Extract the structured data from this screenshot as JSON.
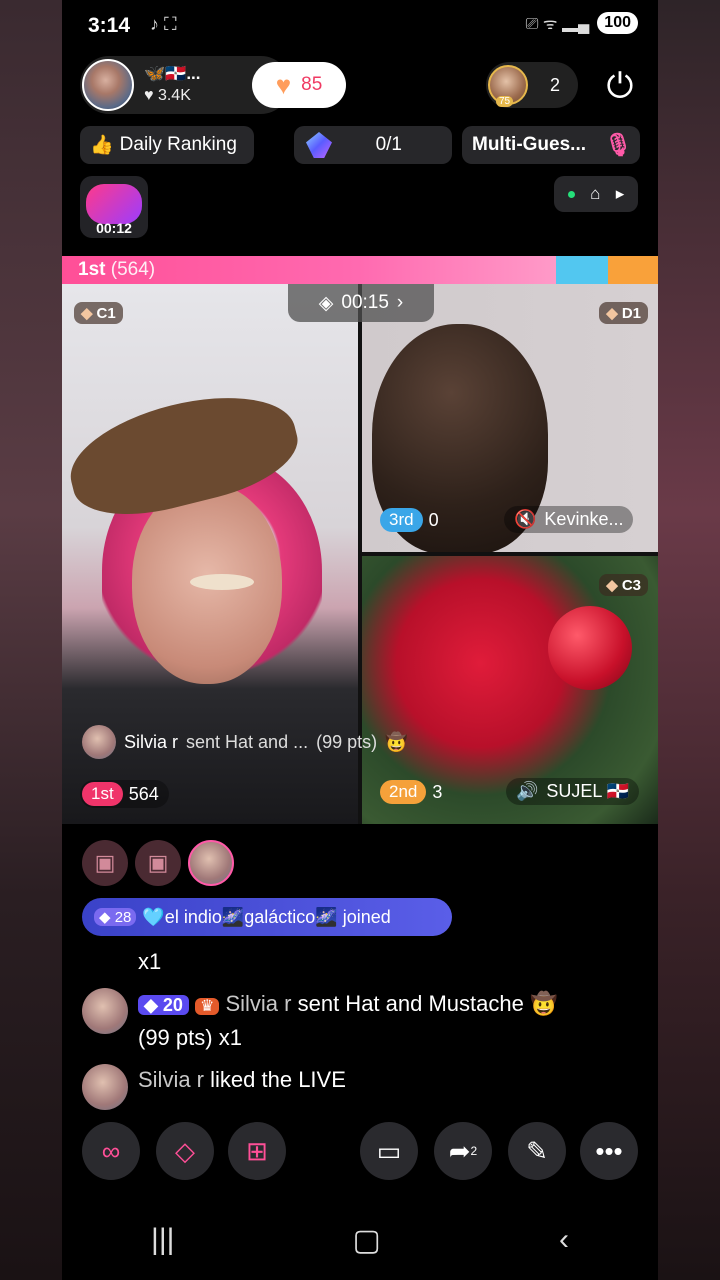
{
  "status": {
    "time": "3:14",
    "battery": "100",
    "left_icons": "♪ ⛶",
    "right_icons": "⎚ ᯤ ▂▄"
  },
  "host": {
    "name": "🦋🇩🇴...",
    "likes": "♥ 3.4K"
  },
  "like_counter": "85",
  "viewers": {
    "badge": "75",
    "count": "2"
  },
  "chips": {
    "ranking": "Daily Ranking",
    "gem_progress": "0/1",
    "multi_guest": "Multi-Gues..."
  },
  "game": {
    "timer": "00:12"
  },
  "battle_bar": {
    "label": "1st",
    "score": "(564)"
  },
  "battle_timer": "00:15",
  "tiles": {
    "c1": {
      "tag": "C1",
      "rank": "1st",
      "score": "564"
    },
    "d1": {
      "tag": "D1",
      "rank": "3rd",
      "score": "0",
      "name": "Kevinke..."
    },
    "c3": {
      "tag": "C3",
      "rank": "2nd",
      "score": "3",
      "name": "SUJEL 🇩🇴"
    }
  },
  "gift_overlay": {
    "user": "Silvia r",
    "text": "sent Hat and ...",
    "pts": "(99 pts)"
  },
  "joined": {
    "level": "28",
    "text": "🩵el indio🌌galáctico🌌 joined"
  },
  "comments": [
    {
      "text": "x1"
    },
    {
      "level": "20",
      "name": "Silvia r",
      "text": "sent Hat and Mustache 🤠",
      "line2": "(99 pts) x1"
    },
    {
      "name": "Silvia r",
      "text": "liked the LIVE"
    }
  ],
  "bottom_buttons": [
    "link-icon",
    "gift-icon",
    "apps-icon",
    "comment-icon",
    "share-icon",
    "magic-wand-icon",
    "more-icon"
  ],
  "share_count": "2",
  "colors": {
    "accent_pink": "#f0346a",
    "blue_bar": "#52c7f0",
    "orange_bar": "#f9a13a",
    "joined_blue": "#3a42c8"
  }
}
